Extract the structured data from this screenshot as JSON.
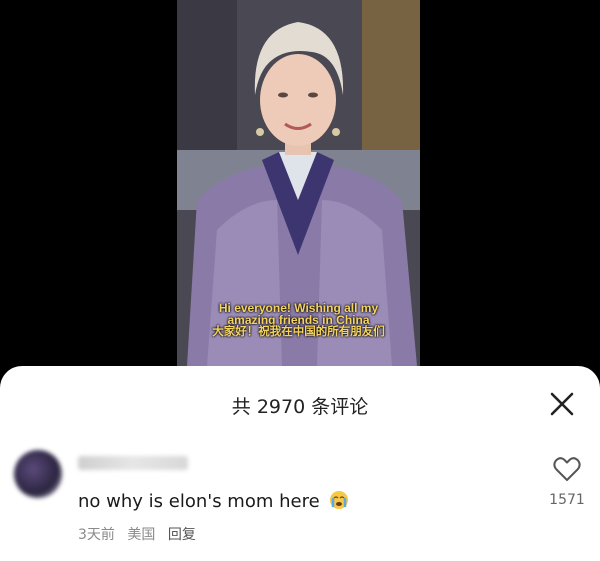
{
  "video": {
    "subtitle_en_line1": "Hi everyone! Wishing all my",
    "subtitle_en_line2": "amazing friends in China",
    "subtitle_zh": "大家好！祝我在中国的所有朋友们"
  },
  "comments_panel": {
    "title": "共 2970 条评论",
    "close_icon": "close-icon",
    "comment": {
      "text": "no why is elon's mom here",
      "emoji": "crying-face",
      "time": "3天前",
      "location": "美国",
      "reply_label": "回复",
      "like_icon": "heart-outline-icon",
      "like_count": "1571"
    }
  },
  "colors": {
    "subtitle": "#f4d35e",
    "sheet_bg": "#ffffff",
    "page_bg": "#000000"
  }
}
